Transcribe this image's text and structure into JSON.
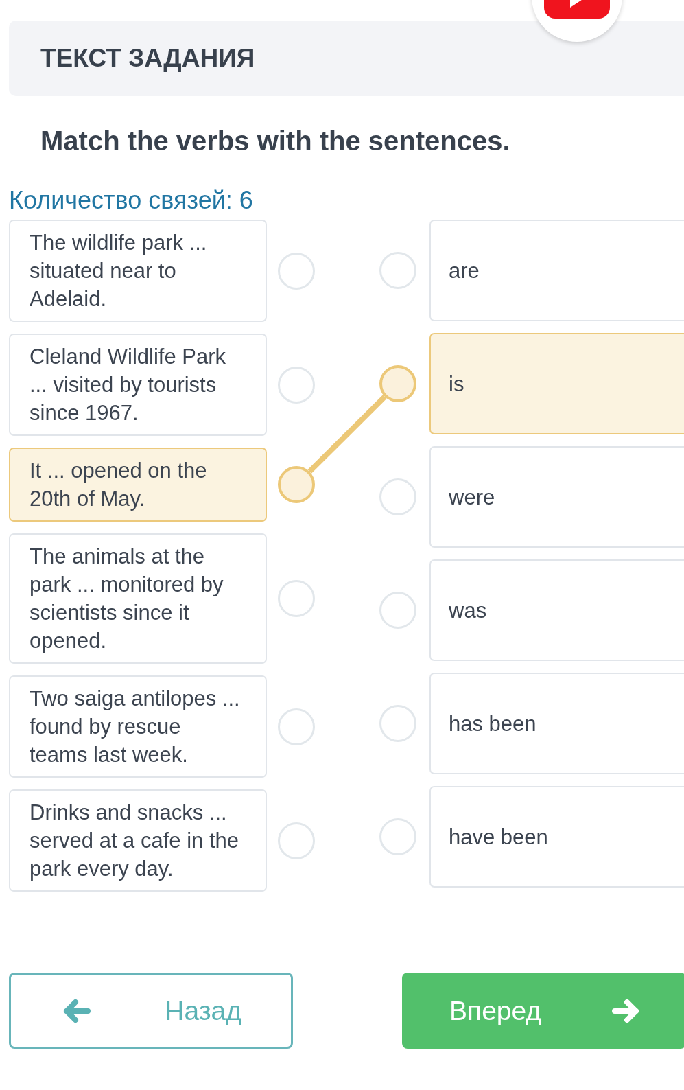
{
  "header": {
    "title": "ТЕКСТ ЗАДАНИЯ"
  },
  "instruction": "Match the verbs with the sentences.",
  "connection_count": "Количество связей: 6",
  "sentences": [
    {
      "text": "The wildlife park ... situated near to Adelaid.",
      "linked": false
    },
    {
      "text": "Cleland Wildlife Park ... visited by tourists since 1967.",
      "linked": false
    },
    {
      "text": "It ... opened on the 20th of May.",
      "linked": true
    },
    {
      "text": "The animals at the park ... monitored by scientists since it opened.",
      "linked": false
    },
    {
      "text": "Two saiga antilopes ... found by rescue teams last week.",
      "linked": false
    },
    {
      "text": "Drinks and snacks ... served at a cafe in the park every day.",
      "linked": false
    }
  ],
  "verbs": [
    {
      "text": "are",
      "linked": false
    },
    {
      "text": "is",
      "linked": true
    },
    {
      "text": "were",
      "linked": false
    },
    {
      "text": "was",
      "linked": false
    },
    {
      "text": "has been",
      "linked": false
    },
    {
      "text": "have been",
      "linked": false
    }
  ],
  "buttons": [
    {
      "label": "Назад",
      "kind": "back"
    },
    {
      "label": "Вперед",
      "kind": "next"
    }
  ]
}
